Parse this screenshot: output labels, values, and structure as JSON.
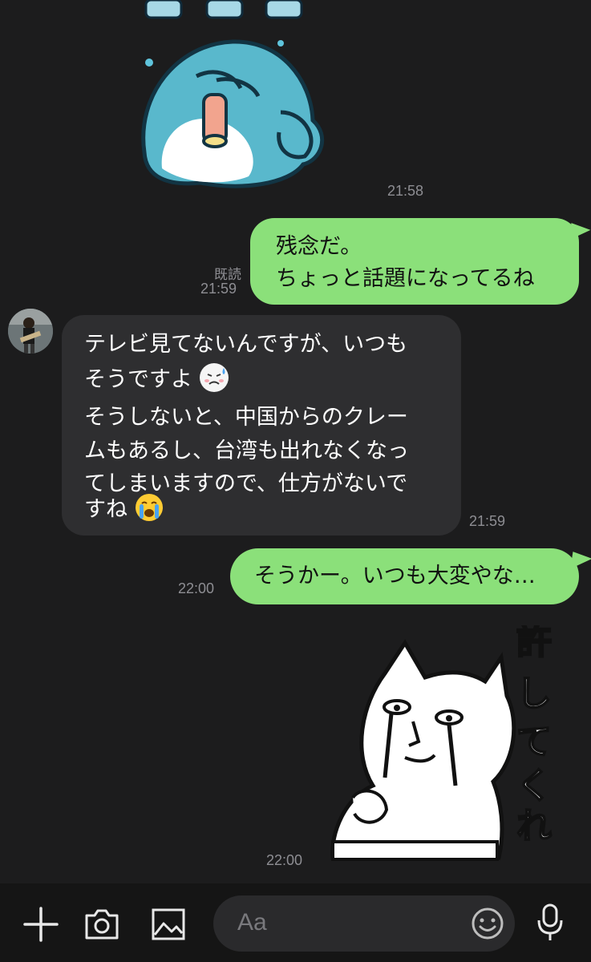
{
  "messages": {
    "m1_time": "21:58",
    "m2": {
      "line1": "残念だ。",
      "line2": "ちょっと話題になってるね",
      "read": "既読",
      "time": "21:59"
    },
    "m3": {
      "line1": "テレビ見てないんですが、いつも",
      "line2": "そうですよ",
      "line3": "そうしないと、中国からのクレー",
      "line4": "ムもあるし、台湾も出れなくなっ",
      "line5": "てしまいますので、仕方がないで",
      "line6": "すね",
      "time": "21:59"
    },
    "m4": {
      "text": "そうかー。いつも大変やな…",
      "time": "22:00"
    },
    "m5": {
      "sticker_text": "許してくれ",
      "time": "22:00"
    }
  },
  "input": {
    "placeholder": "Aa"
  },
  "icons": {
    "plus": "plus-icon",
    "camera": "camera-icon",
    "image": "image-icon",
    "emoji": "smiley-icon",
    "mic": "microphone-icon"
  },
  "colors": {
    "background": "#1c1c1d",
    "outgoing": "#8be07a",
    "incoming": "#2e2e30",
    "timestamp": "#8e8e93"
  }
}
